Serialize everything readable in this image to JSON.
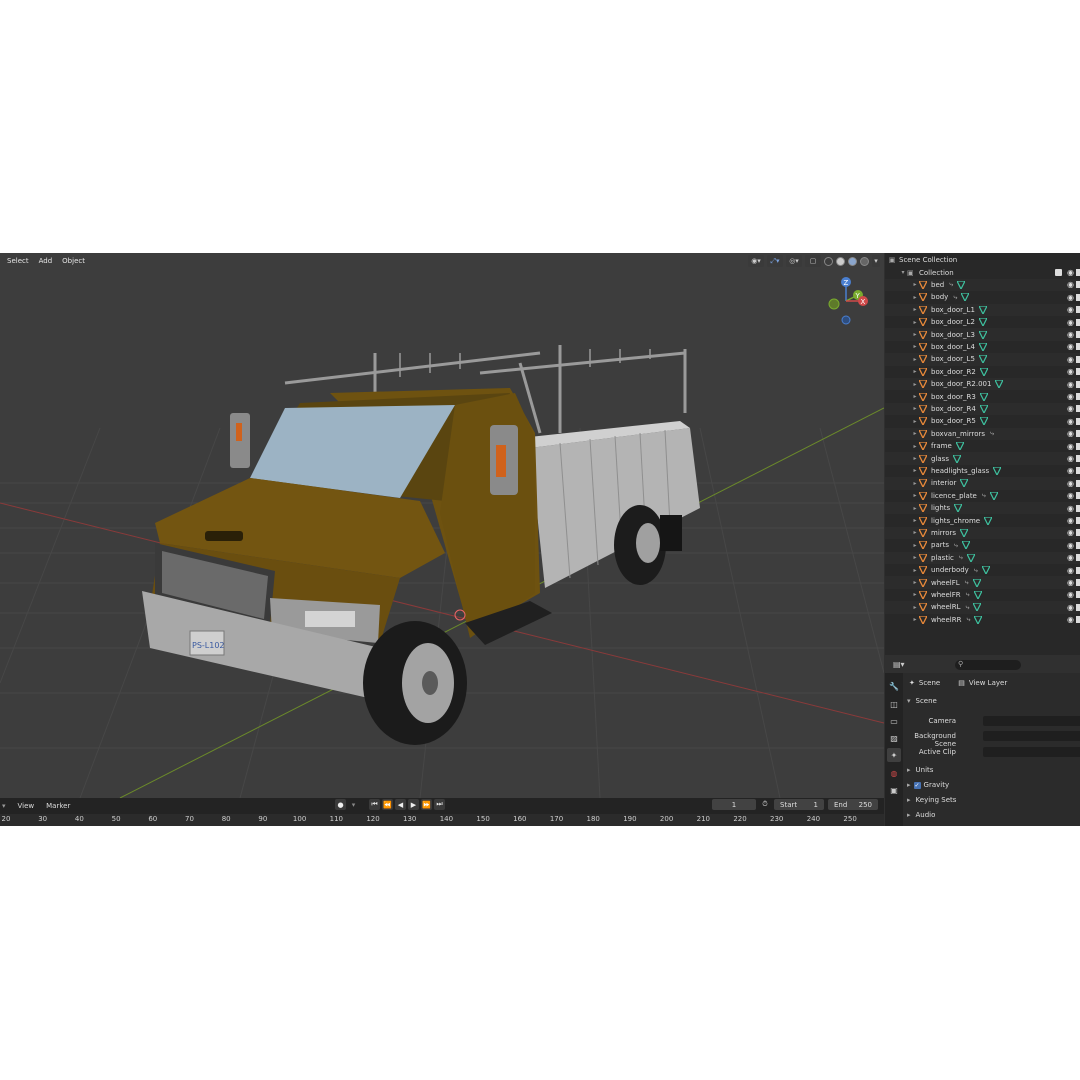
{
  "viewport": {
    "menu": [
      "Select",
      "Add",
      "Object"
    ],
    "gizmo_labels": {
      "z": "Z",
      "y": "Y",
      "x": "X"
    },
    "license_plate": "PS-L102"
  },
  "timeline": {
    "menu": [
      "View",
      "Marker"
    ],
    "current_frame": "1",
    "start_label": "Start",
    "start_value": "1",
    "end_label": "End",
    "end_value": "250",
    "ruler": [
      "20",
      "30",
      "40",
      "50",
      "60",
      "70",
      "80",
      "90",
      "100",
      "110",
      "120",
      "130",
      "140",
      "150",
      "160",
      "170",
      "180",
      "190",
      "200",
      "210",
      "220",
      "230",
      "240",
      "250"
    ]
  },
  "outliner": {
    "root": "Scene Collection",
    "collection": "Collection",
    "objects": [
      {
        "name": "bed",
        "mods": [
          "link",
          "mesh"
        ]
      },
      {
        "name": "body",
        "mods": [
          "link",
          "mesh"
        ]
      },
      {
        "name": "box_door_L1",
        "mods": [
          "mesh"
        ]
      },
      {
        "name": "box_door_L2",
        "mods": [
          "mesh"
        ]
      },
      {
        "name": "box_door_L3",
        "mods": [
          "mesh"
        ]
      },
      {
        "name": "box_door_L4",
        "mods": [
          "mesh"
        ]
      },
      {
        "name": "box_door_L5",
        "mods": [
          "mesh"
        ]
      },
      {
        "name": "box_door_R2",
        "mods": [
          "mesh"
        ]
      },
      {
        "name": "box_door_R2.001",
        "mods": [
          "mesh"
        ]
      },
      {
        "name": "box_door_R3",
        "mods": [
          "mesh"
        ]
      },
      {
        "name": "box_door_R4",
        "mods": [
          "mesh"
        ]
      },
      {
        "name": "box_door_R5",
        "mods": [
          "mesh"
        ]
      },
      {
        "name": "boxvan_mirrors",
        "mods": [
          "link"
        ]
      },
      {
        "name": "frame",
        "mods": [
          "mesh"
        ]
      },
      {
        "name": "glass",
        "mods": [
          "mesh"
        ]
      },
      {
        "name": "headlights_glass",
        "mods": [
          "mesh"
        ]
      },
      {
        "name": "interior",
        "mods": [
          "mesh"
        ]
      },
      {
        "name": "licence_plate",
        "mods": [
          "link",
          "mesh"
        ]
      },
      {
        "name": "lights",
        "mods": [
          "mesh"
        ]
      },
      {
        "name": "lights_chrome",
        "mods": [
          "mesh"
        ]
      },
      {
        "name": "mirrors",
        "mods": [
          "mesh"
        ]
      },
      {
        "name": "parts",
        "mods": [
          "link",
          "mesh"
        ]
      },
      {
        "name": "plastic",
        "mods": [
          "link",
          "mesh"
        ]
      },
      {
        "name": "underbody",
        "mods": [
          "link",
          "mesh"
        ]
      },
      {
        "name": "wheelFL",
        "mods": [
          "link",
          "mesh"
        ]
      },
      {
        "name": "wheelFR",
        "mods": [
          "link",
          "mesh"
        ]
      },
      {
        "name": "wheelRL",
        "mods": [
          "link",
          "mesh"
        ]
      },
      {
        "name": "wheelRR",
        "mods": [
          "link",
          "mesh"
        ]
      }
    ]
  },
  "properties": {
    "tabs": {
      "scene": "Scene",
      "view_layer": "View Layer"
    },
    "section_scene": "Scene",
    "camera_label": "Camera",
    "background_label": "Background Scene",
    "clip_label": "Active Clip",
    "subsections": [
      "Units",
      "Gravity",
      "Keying Sets",
      "Audio"
    ]
  },
  "colors": {
    "accent": "#4772b3",
    "object_orange": "#e8893a",
    "mesh_green": "#3ec2a0",
    "truck_body": "#7a5a10"
  }
}
